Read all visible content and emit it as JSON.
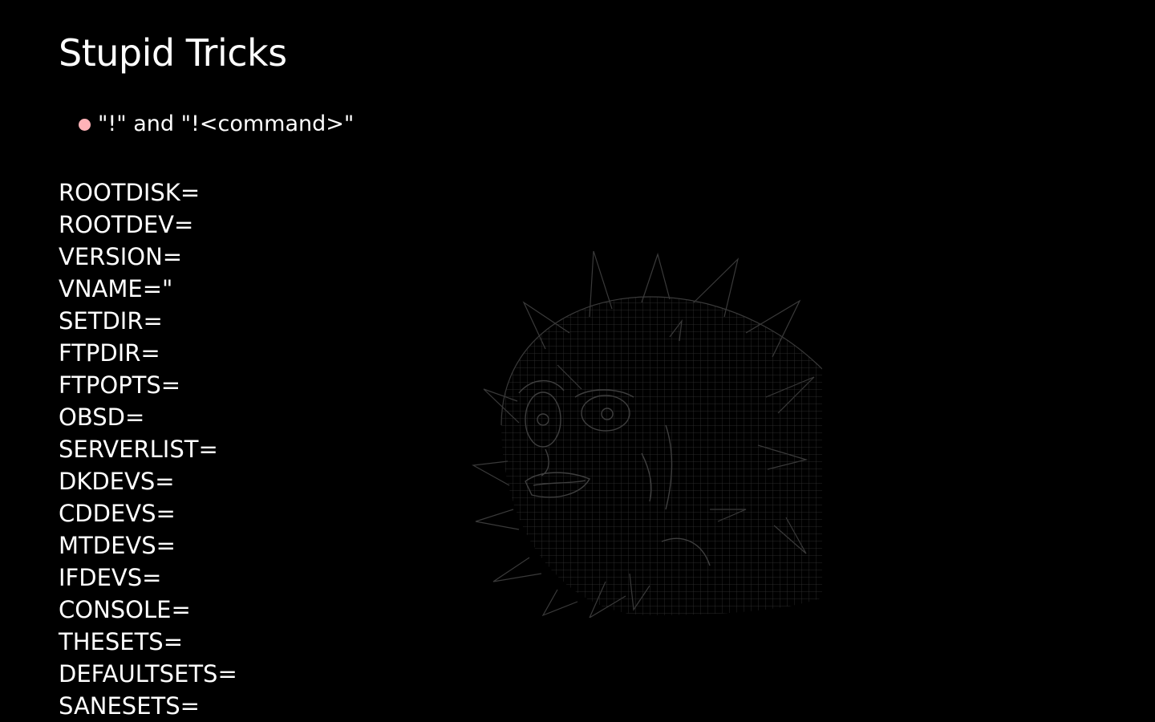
{
  "slide": {
    "title": "Stupid Tricks",
    "bullets": [
      "\"!\" and \"!<command>\""
    ],
    "variables": [
      "ROOTDISK=",
      "ROOTDEV=",
      "VERSION=",
      "VNAME=\"",
      "SETDIR=",
      "FTPDIR=",
      "FTPOPTS=",
      "OBSD=",
      "SERVERLIST=",
      "DKDEVS=",
      "CDDEVS=",
      "MTDEVS=",
      "IFDEVS=",
      "CONSOLE=",
      "THESETS=",
      "DEFAULTSETS=",
      "SANESETS="
    ]
  },
  "colors": {
    "background": "#000000",
    "text": "#ffffff",
    "bullet": "#ffb3b8",
    "mascot_wireframe": "#3a3a3a"
  },
  "icons": {
    "mascot": "pufferfish-wireframe-icon"
  }
}
